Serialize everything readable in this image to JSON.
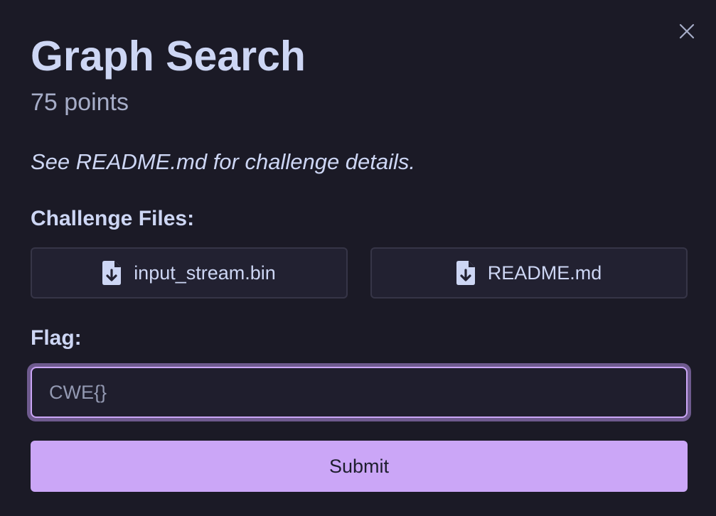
{
  "challenge": {
    "title": "Graph Search",
    "points": "75 points",
    "description": "See README.md for challenge details."
  },
  "files": {
    "label": "Challenge Files:",
    "items": [
      {
        "name": "input_stream.bin",
        "icon": "file-download-icon"
      },
      {
        "name": "README.md",
        "icon": "file-download-icon"
      }
    ]
  },
  "flag": {
    "label": "Flag:",
    "value": "",
    "placeholder": "CWE{}"
  },
  "submit": {
    "label": "Submit"
  },
  "colors": {
    "background": "#1b1a26",
    "text": "#cdd6f4",
    "muted": "#a6adc8",
    "accent": "#cba6f7",
    "button_bg": "#222131",
    "button_border": "#363547"
  }
}
